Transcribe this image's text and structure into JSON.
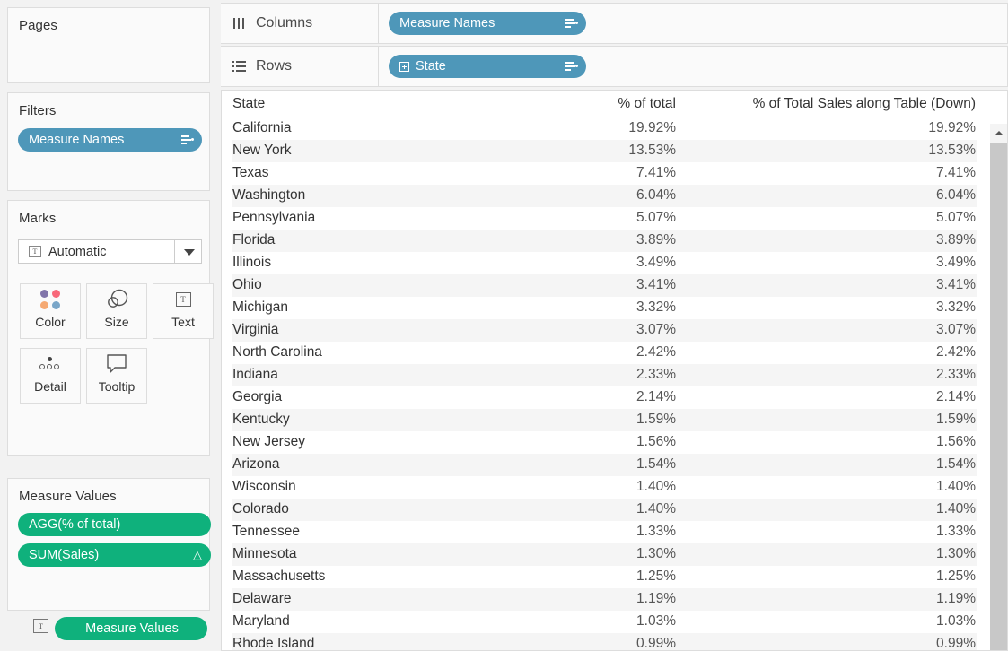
{
  "left_panel": {
    "pages": {
      "title": "Pages"
    },
    "filters": {
      "title": "Filters",
      "pills": [
        {
          "label": "Measure Names",
          "color": "#4e97b9",
          "glyph": "filter-sort-icon"
        }
      ]
    },
    "marks": {
      "title": "Marks",
      "mark_type": "Automatic",
      "mark_type_icon": "text-mark-icon",
      "dropdown_icon": "chevron-down-icon",
      "buttons": [
        {
          "label": "Color",
          "icon": "color-dots-icon"
        },
        {
          "label": "Size",
          "icon": "size-circles-icon"
        },
        {
          "label": "Text",
          "icon": "text-box-icon"
        },
        {
          "label": "Detail",
          "icon": "detail-dots-icon"
        },
        {
          "label": "Tooltip",
          "icon": "tooltip-bubble-icon"
        }
      ],
      "on_text_pill": {
        "label": "Measure Values",
        "color": "#0fb17c",
        "prefix_icon": "text-mark-icon"
      }
    },
    "measure_values": {
      "title": "Measure Values",
      "pills": [
        {
          "label": "AGG(% of total)",
          "color": "#0fb17c",
          "suffix_icon": ""
        },
        {
          "label": "SUM(Sales)",
          "color": "#0fb17c",
          "suffix_icon": "delta-icon",
          "suffix_glyph": "△"
        }
      ]
    }
  },
  "shelves": {
    "columns": {
      "label": "Columns",
      "icon": "columns-icon",
      "pill": {
        "label": "Measure Names",
        "color": "#4e97b9",
        "glyph": "filter-sort-icon"
      }
    },
    "rows": {
      "label": "Rows",
      "icon": "rows-icon",
      "pill": {
        "label": "State",
        "color": "#4e97b9",
        "glyph": "filter-sort-icon",
        "expand_icon": "expand-plus-icon"
      }
    }
  },
  "view": {
    "scrollbar": {
      "up_icon": "chevron-up-icon",
      "position": "top"
    },
    "table": {
      "headers": [
        "State",
        "% of total",
        "% of Total Sales along Table (Down)"
      ],
      "rows": [
        [
          "California",
          "19.92%",
          "19.92%"
        ],
        [
          "New York",
          "13.53%",
          "13.53%"
        ],
        [
          "Texas",
          "7.41%",
          "7.41%"
        ],
        [
          "Washington",
          "6.04%",
          "6.04%"
        ],
        [
          "Pennsylvania",
          "5.07%",
          "5.07%"
        ],
        [
          "Florida",
          "3.89%",
          "3.89%"
        ],
        [
          "Illinois",
          "3.49%",
          "3.49%"
        ],
        [
          "Ohio",
          "3.41%",
          "3.41%"
        ],
        [
          "Michigan",
          "3.32%",
          "3.32%"
        ],
        [
          "Virginia",
          "3.07%",
          "3.07%"
        ],
        [
          "North Carolina",
          "2.42%",
          "2.42%"
        ],
        [
          "Indiana",
          "2.33%",
          "2.33%"
        ],
        [
          "Georgia",
          "2.14%",
          "2.14%"
        ],
        [
          "Kentucky",
          "1.59%",
          "1.59%"
        ],
        [
          "New Jersey",
          "1.56%",
          "1.56%"
        ],
        [
          "Arizona",
          "1.54%",
          "1.54%"
        ],
        [
          "Wisconsin",
          "1.40%",
          "1.40%"
        ],
        [
          "Colorado",
          "1.40%",
          "1.40%"
        ],
        [
          "Tennessee",
          "1.33%",
          "1.33%"
        ],
        [
          "Minnesota",
          "1.30%",
          "1.30%"
        ],
        [
          "Massachusetts",
          "1.25%",
          "1.25%"
        ],
        [
          "Delaware",
          "1.19%",
          "1.19%"
        ],
        [
          "Maryland",
          "1.03%",
          "1.03%"
        ],
        [
          "Rhode Island",
          "0.99%",
          "0.99%"
        ]
      ]
    }
  },
  "chart_data": {
    "type": "table",
    "title": "",
    "categories": [
      "California",
      "New York",
      "Texas",
      "Washington",
      "Pennsylvania",
      "Florida",
      "Illinois",
      "Ohio",
      "Michigan",
      "Virginia",
      "North Carolina",
      "Indiana",
      "Georgia",
      "Kentucky",
      "New Jersey",
      "Arizona",
      "Wisconsin",
      "Colorado",
      "Tennessee",
      "Minnesota",
      "Massachusetts",
      "Delaware",
      "Maryland",
      "Rhode Island"
    ],
    "series": [
      {
        "name": "% of total",
        "values": [
          19.92,
          13.53,
          7.41,
          6.04,
          5.07,
          3.89,
          3.49,
          3.41,
          3.32,
          3.07,
          2.42,
          2.33,
          2.14,
          1.59,
          1.56,
          1.54,
          1.4,
          1.4,
          1.33,
          1.3,
          1.25,
          1.19,
          1.03,
          0.99
        ]
      },
      {
        "name": "% of Total Sales along Table (Down)",
        "values": [
          19.92,
          13.53,
          7.41,
          6.04,
          5.07,
          3.89,
          3.49,
          3.41,
          3.32,
          3.07,
          2.42,
          2.33,
          2.14,
          1.59,
          1.56,
          1.54,
          1.4,
          1.4,
          1.33,
          1.3,
          1.25,
          1.19,
          1.03,
          0.99
        ]
      }
    ],
    "xlabel": "State",
    "ylabel": "",
    "units": "percent"
  },
  "colors": {
    "dimension_pill": "#4e97b9",
    "measure_pill": "#0fb17c",
    "panel_bg": "#f2f2f2",
    "card_bg": "#fafafa",
    "row_alt": "#f5f5f5"
  }
}
